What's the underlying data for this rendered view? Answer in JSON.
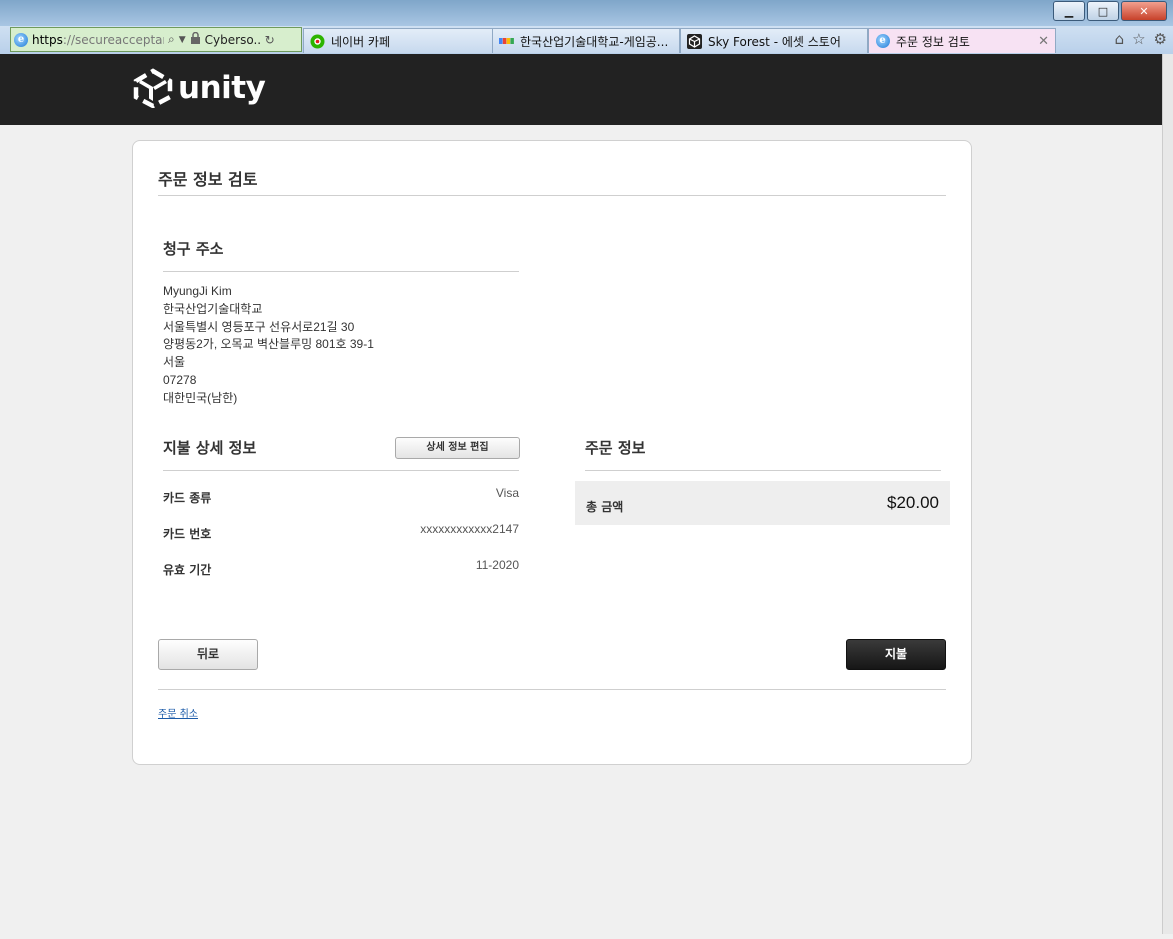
{
  "browser": {
    "address": {
      "url_protocol": "https",
      "url_rest": "://secureacceptan...",
      "site_name": "Cyberso..."
    },
    "tabs": [
      {
        "label": "네이버 카페",
        "icon": "naver-cafe-icon"
      },
      {
        "label": "한국산업기술대학교-게임공...",
        "icon": "google-icon"
      },
      {
        "label": "Sky Forest - 에셋 스토어",
        "icon": "unity-icon"
      },
      {
        "label": "주문 정보 검토",
        "icon": "ie-icon",
        "active": true
      }
    ],
    "window_buttons": [
      "minimize",
      "maximize",
      "close"
    ],
    "colors": {
      "secure_address_bg": "#d7eecd",
      "active_tab_bg": "#f7e2f3"
    }
  },
  "header": {
    "logo_text": "unity",
    "logo_icon": "unity-cube-icon",
    "bg_color": "#222222"
  },
  "page": {
    "title": "주문 정보 검토",
    "billing": {
      "heading": "청구 주소",
      "lines": [
        "MyungJi Kim",
        "한국산업기술대학교",
        "서울특별시 영등포구 선유서로21길 30",
        "양평동2가, 오목교 벽산블루밍 801호 39-1",
        "서울",
        "07278",
        "대한민국(남한)"
      ]
    },
    "payment": {
      "heading": "지불 상세 정보",
      "edit_button": "상세 정보 편집",
      "rows": [
        {
          "label": "카드 종류",
          "value": "Visa"
        },
        {
          "label": "카드 번호",
          "value": "xxxxxxxxxxxx2147"
        },
        {
          "label": "유효 기간",
          "value": "11-2020"
        }
      ]
    },
    "order": {
      "heading": "주문 정보",
      "total_label": "총 금액",
      "total_value": "$20.00"
    },
    "back_button": "뒤로",
    "pay_button": "지불",
    "cancel_link": "주문 취소"
  }
}
